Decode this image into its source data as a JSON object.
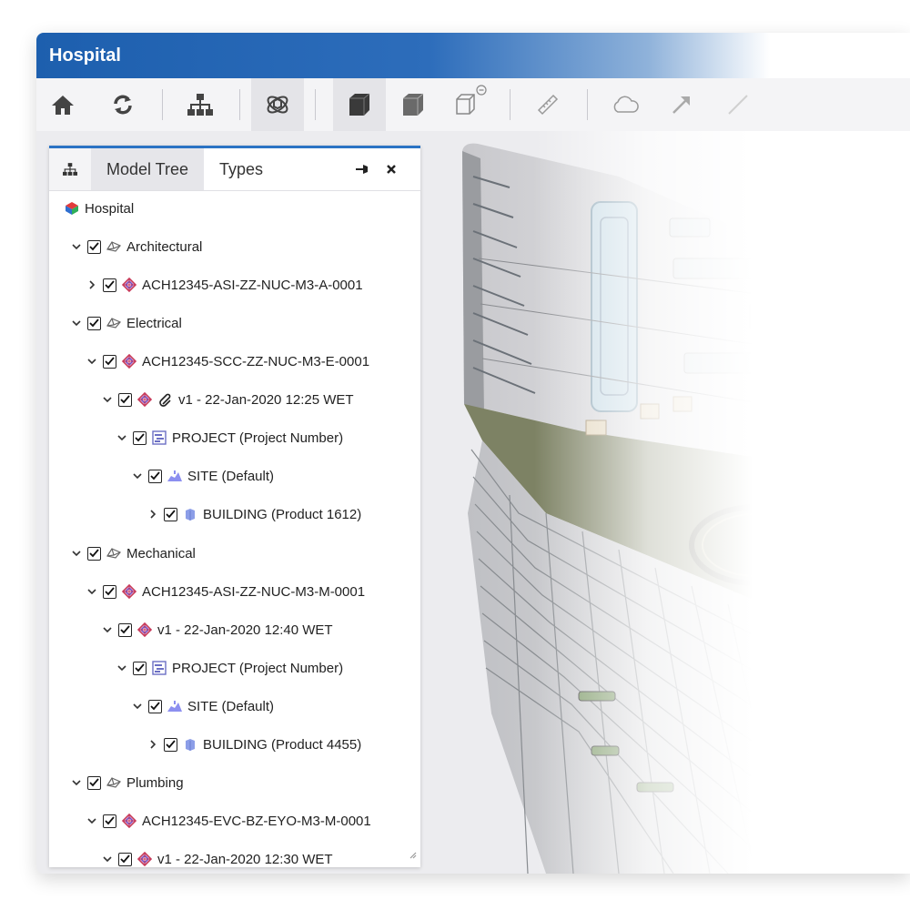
{
  "window": {
    "title": "Hospital"
  },
  "toolbar": {
    "buttons": [
      {
        "name": "home-icon"
      },
      {
        "name": "refresh-icon"
      },
      {
        "name": "hierarchy-icon"
      },
      {
        "name": "explode-icon",
        "active": true
      },
      {
        "name": "solid-view-icon"
      },
      {
        "name": "shaded-view-icon"
      },
      {
        "name": "wireframe-view-icon"
      },
      {
        "name": "measure-icon"
      },
      {
        "name": "cloud-icon"
      },
      {
        "name": "arrow-icon"
      },
      {
        "name": "line-icon"
      }
    ]
  },
  "panel": {
    "tabs": [
      "Model Tree",
      "Types"
    ],
    "root": "Hospital",
    "items": [
      {
        "label": "Architectural",
        "icon": "discipline-icon"
      },
      {
        "label": "ACH12345-ASI-ZZ-NUC-M3-A-0001",
        "icon": "model-icon"
      },
      {
        "label": "Electrical",
        "icon": "discipline-icon"
      },
      {
        "label": "ACH12345-SCC-ZZ-NUC-M3-E-0001",
        "icon": "model-icon"
      },
      {
        "label": "v1 - 22-Jan-2020 12:25 WET",
        "icon": "model-icon"
      },
      {
        "label": "PROJECT (Project Number)",
        "icon": "project-icon"
      },
      {
        "label": "SITE (Default)",
        "icon": "site-icon"
      },
      {
        "label": "BUILDING (Product 1612)",
        "icon": "building-icon"
      },
      {
        "label": "Mechanical",
        "icon": "discipline-icon"
      },
      {
        "label": "ACH12345-ASI-ZZ-NUC-M3-M-0001",
        "icon": "model-icon"
      },
      {
        "label": "v1 - 22-Jan-2020 12:40 WET",
        "icon": "model-icon"
      },
      {
        "label": "PROJECT (Project Number)",
        "icon": "project-icon"
      },
      {
        "label": "SITE (Default)",
        "icon": "site-icon"
      },
      {
        "label": "BUILDING (Product 4455)",
        "icon": "building-icon"
      },
      {
        "label": "Plumbing",
        "icon": "discipline-icon"
      },
      {
        "label": "ACH12345-EVC-BZ-EYO-M3-M-0001",
        "icon": "model-icon"
      },
      {
        "label": "v1 - 22-Jan-2020 12:30 WET",
        "icon": "model-icon"
      }
    ]
  },
  "colors": {
    "accent": "#2b73c4",
    "title_bar": "#1d5fae"
  }
}
